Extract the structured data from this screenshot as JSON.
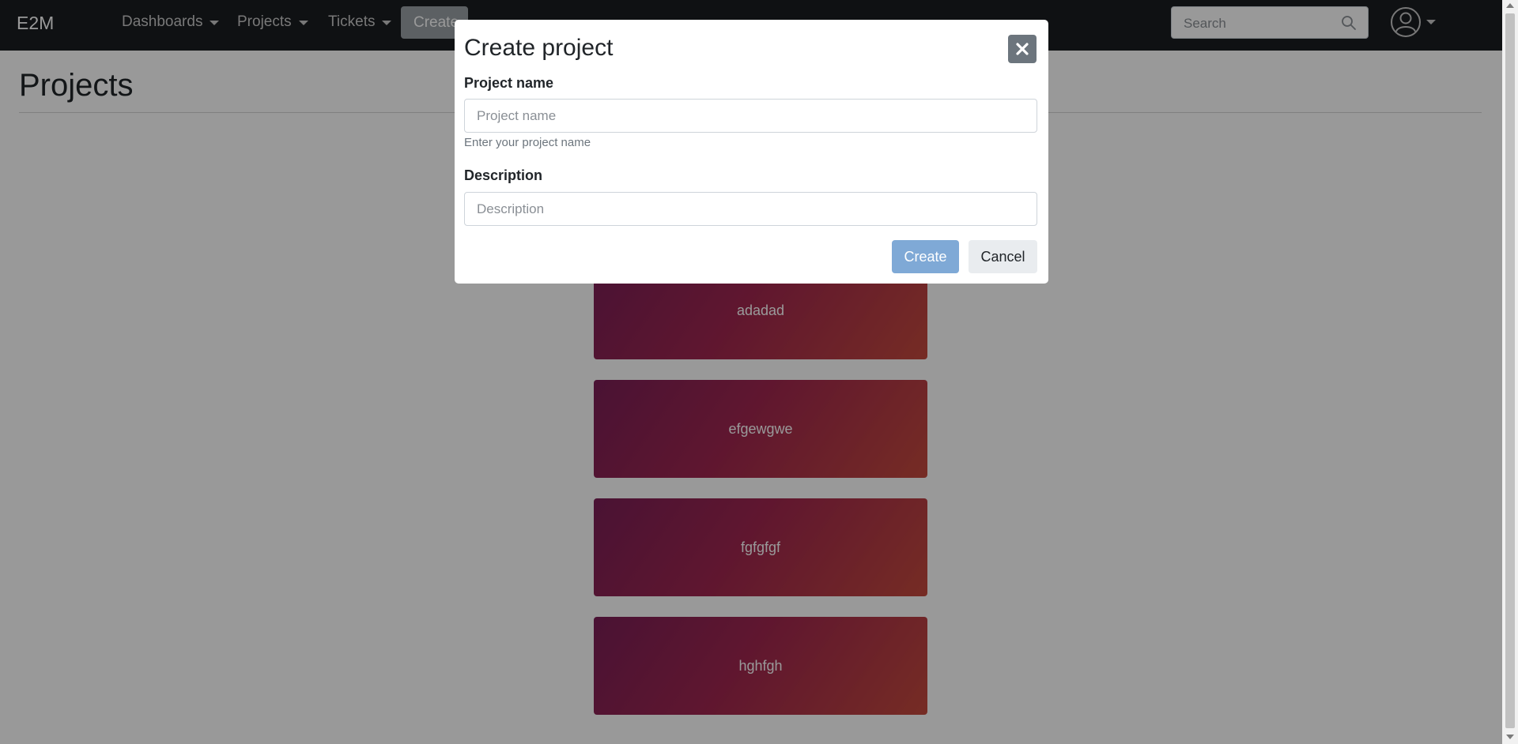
{
  "navbar": {
    "brand": "E2M",
    "menu": [
      {
        "label": "Dashboards"
      },
      {
        "label": "Projects"
      },
      {
        "label": "Tickets"
      }
    ],
    "create_label": "Create",
    "search": {
      "placeholder": "Search",
      "value": ""
    }
  },
  "page": {
    "title": "Projects",
    "projects": [
      {
        "name": "adadad"
      },
      {
        "name": "efgewgwe"
      },
      {
        "name": "fgfgfgf"
      },
      {
        "name": "hghfgh"
      }
    ]
  },
  "modal": {
    "title": "Create project",
    "fields": {
      "name": {
        "label": "Project name",
        "placeholder": "Project name",
        "value": "",
        "help": "Enter your project name"
      },
      "description": {
        "label": "Description",
        "placeholder": "Description",
        "value": ""
      }
    },
    "create_label": "Create",
    "cancel_label": "Cancel"
  },
  "colors": {
    "navbar": "#1a1d21",
    "primary_button": "#7fa9d6",
    "card_gradient": [
      "#7b1f57",
      "#a0264f",
      "#c54a3d"
    ]
  },
  "icons": {
    "search": "search-icon",
    "avatar": "user-circle-icon",
    "close": "close-icon"
  }
}
